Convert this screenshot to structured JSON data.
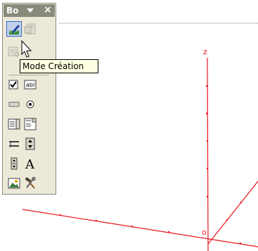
{
  "toolbox": {
    "title": "Bo",
    "menu_icon": "chevron-down-icon",
    "close_label": "×",
    "tools": [
      {
        "name": "design-mode",
        "icon": "design-ruler-pencil-icon",
        "state": "pressed"
      },
      {
        "name": "properties",
        "icon": "properties-icon",
        "state": "disabled"
      },
      {
        "name": "view-code",
        "icon": "view-code-icon",
        "state": "disabled"
      },
      {
        "name": "check-box",
        "icon": "checkbox-icon"
      },
      {
        "name": "text-box",
        "icon": "textbox-icon",
        "text": "abl"
      },
      {
        "name": "command-button",
        "icon": "command-button-icon"
      },
      {
        "name": "option-button",
        "icon": "option-button-icon"
      },
      {
        "name": "list-box",
        "icon": "list-box-icon"
      },
      {
        "name": "combo-box",
        "icon": "combo-box-icon"
      },
      {
        "name": "toggle-button",
        "icon": "toggle-button-icon"
      },
      {
        "name": "spin-button",
        "icon": "spin-button-icon"
      },
      {
        "name": "scroll-bar",
        "icon": "scroll-bar-icon"
      },
      {
        "name": "label",
        "icon": "label-a-icon",
        "text": "A"
      },
      {
        "name": "image",
        "icon": "image-icon"
      },
      {
        "name": "more-controls",
        "icon": "hammer-wrench-icon"
      }
    ]
  },
  "tooltip": {
    "text": "Mode Création"
  },
  "canvas": {
    "axis_z_label": "z",
    "origin_label": "o",
    "axis_color": "#e8141b"
  }
}
